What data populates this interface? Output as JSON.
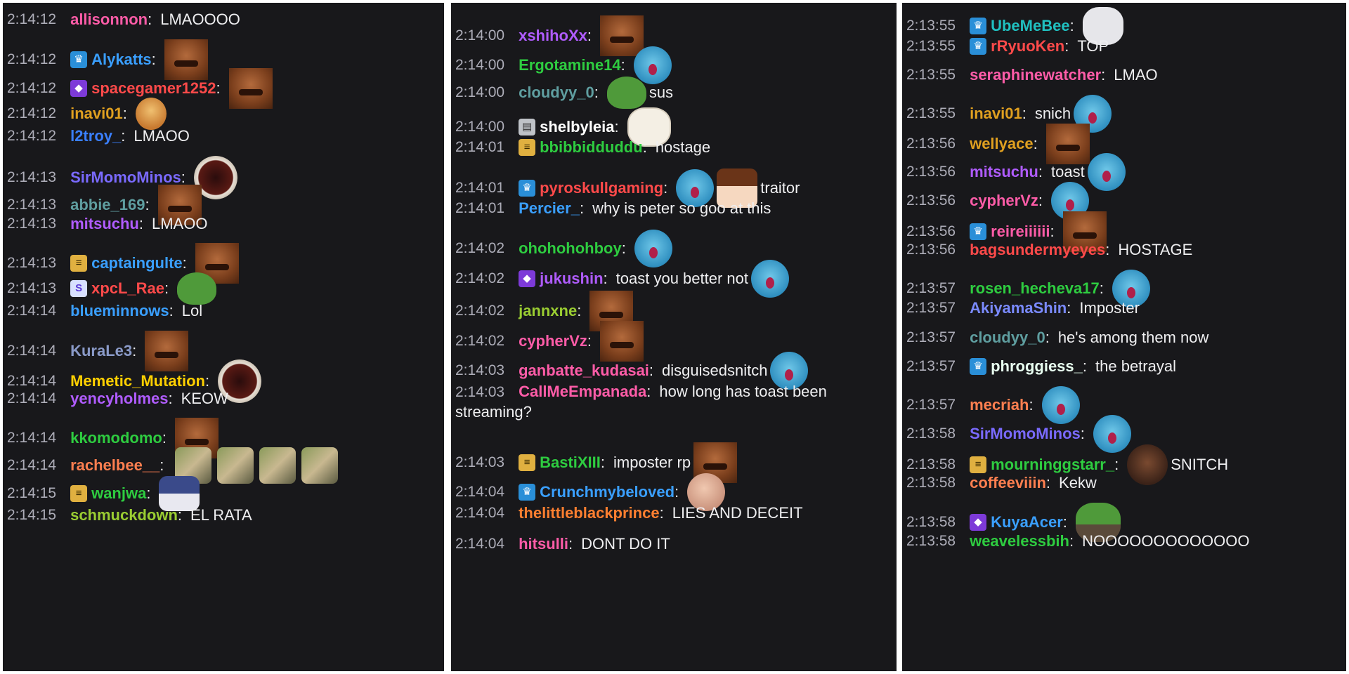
{
  "columns": [
    {
      "id": "col1",
      "messages": [
        {
          "t": "2:14:12",
          "u": "allisonnon",
          "c": "#ff5ca8",
          "x": "LMAOOOO",
          "b": null,
          "e": []
        },
        {
          "t": "2:14:12",
          "u": "Alykatts",
          "c": "#3a9fff",
          "x": "",
          "b": "crown",
          "e": [
            "face"
          ]
        },
        {
          "t": "2:14:12",
          "u": "spacegamer1252",
          "c": "#ff4a4a",
          "x": "",
          "b": "prime",
          "e": [
            "face"
          ]
        },
        {
          "t": "2:14:12",
          "u": "inavi01",
          "c": "#e0a020",
          "x": "",
          "b": null,
          "e": [
            "guy"
          ]
        },
        {
          "t": "2:14:12",
          "u": "l2troy_",
          "c": "#3a7fff",
          "x": "LMAOO",
          "b": null,
          "e": []
        },
        {
          "t": "2:14:13",
          "u": "SirMomoMinos",
          "c": "#7a6aff",
          "x": "",
          "b": null,
          "e": [
            "santa"
          ]
        },
        {
          "t": "2:14:13",
          "u": "abbie_169",
          "c": "#5f9ea0",
          "x": "",
          "b": null,
          "e": [
            "face"
          ]
        },
        {
          "t": "2:14:13",
          "u": "mitsuchu",
          "c": "#b05cff",
          "x": "LMAOO",
          "b": null,
          "e": []
        },
        {
          "t": "2:14:13",
          "u": "captaingulte",
          "c": "#3a9fff",
          "x": "",
          "b": "sub",
          "e": [
            "face"
          ]
        },
        {
          "t": "2:14:13",
          "u": "xpcL_Rae",
          "c": "#ff4a4a",
          "x": "",
          "b": "bits",
          "e": [
            "pepe"
          ]
        },
        {
          "t": "2:14:14",
          "u": "blueminnows",
          "c": "#3a9fff",
          "x": "Lol",
          "b": null,
          "e": []
        },
        {
          "t": "2:14:14",
          "u": "KuraLe3",
          "c": "#8a9ac8",
          "x": "",
          "b": null,
          "e": [
            "face"
          ]
        },
        {
          "t": "2:14:14",
          "u": "Memetic_Mutation",
          "c": "#ffd000",
          "x": "",
          "b": null,
          "e": [
            "santa"
          ]
        },
        {
          "t": "2:14:14",
          "u": "yencyholmes",
          "c": "#b05cff",
          "x": "KEOW",
          "b": null,
          "e": []
        },
        {
          "t": "2:14:14",
          "u": "kkomodomo",
          "c": "#2ecc40",
          "x": "",
          "b": null,
          "e": [
            "face"
          ]
        },
        {
          "t": "2:14:14",
          "u": "rachelbee__",
          "c": "#ff7f50",
          "x": "",
          "b": null,
          "e": [
            "facepalm",
            "facepalm",
            "facepalm",
            "facepalm"
          ]
        },
        {
          "t": "2:14:15",
          "u": "wanjwa",
          "c": "#2ecc40",
          "x": "",
          "b": "sub",
          "e": [
            "raccoon"
          ]
        },
        {
          "t": "2:14:15",
          "u": "schmuckdown",
          "c": "#9acd32",
          "x": "EL RATA",
          "b": null,
          "e": []
        }
      ]
    },
    {
      "id": "col2",
      "messages": [
        {
          "t": "2:14:00",
          "u": "xshihoXx",
          "c": "#b05cff",
          "x": "",
          "b": null,
          "e": [
            "face"
          ]
        },
        {
          "t": "2:14:00",
          "u": "Ergotamine14",
          "c": "#2ecc40",
          "x": "",
          "b": null,
          "e": [
            "blob"
          ]
        },
        {
          "t": "2:14:00",
          "u": "cloudyy_0",
          "c": "#5f9ea0",
          "x": "sus",
          "b": null,
          "e": [
            "pepe"
          ]
        },
        {
          "t": "2:14:00",
          "u": "shelbyleia",
          "c": "#ffffff",
          "x": "",
          "b": "grey",
          "e": [
            "cat"
          ]
        },
        {
          "t": "2:14:01",
          "u": "bbibbidduddu",
          "c": "#2ecc40",
          "x": "hostage",
          "b": "sub",
          "e": []
        },
        {
          "t": "2:14:01",
          "u": "pyroskullgaming",
          "c": "#ff4a4a",
          "x": "traitor",
          "b": "crown",
          "e": [
            "blob",
            "anime"
          ]
        },
        {
          "t": "2:14:01",
          "u": "Percier_",
          "c": "#3a9fff",
          "x": "why is peter so goo at this",
          "b": null,
          "e": []
        },
        {
          "t": "2:14:02",
          "u": "ohohohohboy",
          "c": "#2ecc40",
          "x": "",
          "b": null,
          "e": [
            "blob"
          ]
        },
        {
          "t": "2:14:02",
          "u": "jukushin",
          "c": "#b05cff",
          "x": "toast you better not",
          "b": "prime",
          "e": [
            "blob"
          ]
        },
        {
          "t": "2:14:02",
          "u": "jannxne",
          "c": "#9acd32",
          "x": "",
          "b": null,
          "e": [
            "face"
          ]
        },
        {
          "t": "2:14:02",
          "u": "cypherVz",
          "c": "#ff5ca8",
          "x": "",
          "b": null,
          "e": [
            "face"
          ]
        },
        {
          "t": "2:14:03",
          "u": "ganbatte_kudasai",
          "c": "#ff5ca8",
          "x": "disguisedsnitch",
          "b": null,
          "e": [
            "blob"
          ]
        },
        {
          "t": "2:14:03",
          "u": "CallMeEmpanada",
          "c": "#ff5ca8",
          "x": "how long has toast been streaming?",
          "b": null,
          "e": [],
          "wrap": true
        },
        {
          "t": "2:14:03",
          "u": "BastiXIII",
          "c": "#2ecc40",
          "x": "imposter rp",
          "b": "sub",
          "e": [
            "face"
          ]
        },
        {
          "t": "2:14:04",
          "u": "Crunchmybeloved",
          "c": "#3a9fff",
          "x": "",
          "b": "crown",
          "e": [
            "bald"
          ]
        },
        {
          "t": "2:14:04",
          "u": "thelittleblackprince",
          "c": "#ff7f30",
          "x": "LIES AND DECEIT",
          "b": null,
          "e": []
        },
        {
          "t": "2:14:04",
          "u": "hitsulli",
          "c": "#ff5ca8",
          "x": "DONT DO IT",
          "b": null,
          "e": []
        }
      ]
    },
    {
      "id": "col3",
      "messages": [
        {
          "t": "2:13:55",
          "u": "UbeMeBee",
          "c": "#20c0c0",
          "x": "",
          "b": "crown",
          "e": [
            "sheep"
          ]
        },
        {
          "t": "2:13:55",
          "u": "rRyuoKen",
          "c": "#ff4a4a",
          "x": "TOP",
          "b": "crown",
          "e": []
        },
        {
          "t": "2:13:55",
          "u": "seraphinewatcher",
          "c": "#ff5ca8",
          "x": "LMAO",
          "b": null,
          "e": []
        },
        {
          "t": "2:13:55",
          "u": "inavi01",
          "c": "#e0a020",
          "x": "snich",
          "b": null,
          "e": [
            "blob"
          ]
        },
        {
          "t": "2:13:56",
          "u": "wellyace",
          "c": "#e0a020",
          "x": "",
          "b": null,
          "e": [
            "face"
          ]
        },
        {
          "t": "2:13:56",
          "u": "mitsuchu",
          "c": "#b05cff",
          "x": "toast",
          "b": null,
          "e": [
            "blob"
          ]
        },
        {
          "t": "2:13:56",
          "u": "cypherVz",
          "c": "#ff5ca8",
          "x": "",
          "b": null,
          "e": [
            "blob"
          ]
        },
        {
          "t": "2:13:56",
          "u": "reireiiiiii",
          "c": "#ff5ca8",
          "x": "",
          "b": "crown",
          "e": [
            "face"
          ]
        },
        {
          "t": "2:13:56",
          "u": "bagsundermyeyes",
          "c": "#ff4a4a",
          "x": "HOSTAGE",
          "b": null,
          "e": []
        },
        {
          "t": "2:13:57",
          "u": "rosen_hecheva17",
          "c": "#2ecc40",
          "x": "",
          "b": null,
          "e": [
            "blob"
          ]
        },
        {
          "t": "2:13:57",
          "u": "AkiyamaShin",
          "c": "#7a8aff",
          "x": "Imposter",
          "b": null,
          "e": []
        },
        {
          "t": "2:13:57",
          "u": "cloudyy_0",
          "c": "#5f9ea0",
          "x": "he's among them now",
          "b": null,
          "e": []
        },
        {
          "t": "2:13:57",
          "u": "phroggiess_",
          "c": "#e8fff0",
          "x": "the betrayal",
          "b": "crown",
          "e": []
        },
        {
          "t": "2:13:57",
          "u": "mecriah",
          "c": "#ff7f50",
          "x": "",
          "b": null,
          "e": [
            "blob"
          ]
        },
        {
          "t": "2:13:58",
          "u": "SirMomoMinos",
          "c": "#7a6aff",
          "x": "",
          "b": null,
          "e": [
            "blob"
          ]
        },
        {
          "t": "2:13:58",
          "u": "mourninggstarr_",
          "c": "#2ecc40",
          "x": "SNITCH",
          "b": "sub",
          "e": [
            "black"
          ]
        },
        {
          "t": "2:13:58",
          "u": "coffeeviiin",
          "c": "#ff7f50",
          "x": "Kekw",
          "b": null,
          "e": []
        },
        {
          "t": "2:13:58",
          "u": "KuyaAcer",
          "c": "#3a9fff",
          "x": "",
          "b": "prime",
          "e": [
            "pepegun"
          ]
        },
        {
          "t": "2:13:58",
          "u": "weavelessbih",
          "c": "#2ecc40",
          "x": "NOOOOOOOOOOOOO",
          "b": null,
          "e": []
        }
      ]
    }
  ]
}
